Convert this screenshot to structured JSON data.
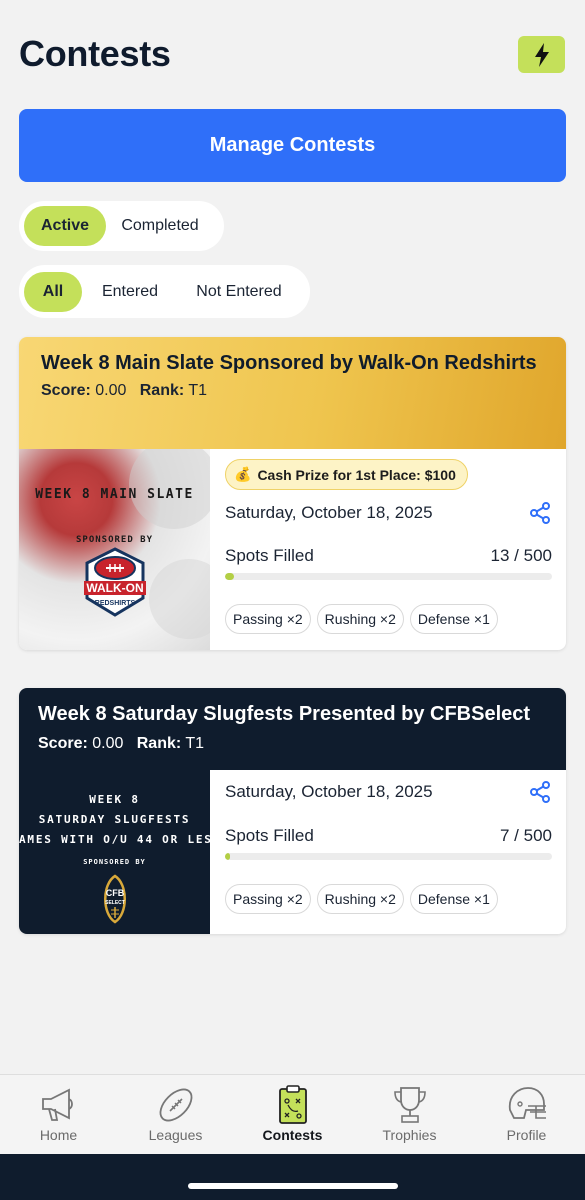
{
  "header": {
    "title": "Contests",
    "action_icon": "lightning-icon"
  },
  "manage_button": "Manage Contests",
  "status_filter": {
    "options": [
      "Active",
      "Completed"
    ],
    "selected": "Active"
  },
  "entry_filter": {
    "options": [
      "All",
      "Entered",
      "Not Entered"
    ],
    "selected": "All"
  },
  "contests": [
    {
      "title": "Week 8 Main Slate Sponsored by Walk-On Redshirts",
      "score_label": "Score:",
      "score": "0.00",
      "rank_label": "Rank:",
      "rank": "T1",
      "thumb": {
        "line1": "WEEK 8 MAIN SLATE",
        "line2": "SPONSORED BY",
        "logo_line1": "WALK-ON",
        "logo_line2": "REDSHIRTS"
      },
      "prize": "Cash Prize for 1st Place: $100",
      "date": "Saturday, October 18, 2025",
      "spots_label": "Spots Filled",
      "spots": "13 / 500",
      "spots_fraction": 0.026,
      "chips": [
        "Passing ×2",
        "Rushing ×2",
        "Defense ×1"
      ]
    },
    {
      "title": "Week 8 Saturday Slugfests Presented by CFBSelect",
      "score_label": "Score:",
      "score": "0.00",
      "rank_label": "Rank:",
      "rank": "T1",
      "thumb": {
        "line1": "WEEK 8",
        "line2": "SATURDAY SLUGFESTS",
        "line3": "AMES WITH O/U 44 OR LES",
        "line4": "SPONSORED BY",
        "logo_line1": "CFB",
        "logo_line2": "SELECT"
      },
      "date": "Saturday, October 18, 2025",
      "spots_label": "Spots Filled",
      "spots": "7 / 500",
      "spots_fraction": 0.014,
      "chips": [
        "Passing ×2",
        "Rushing ×2",
        "Defense ×1"
      ]
    }
  ],
  "tabs": [
    {
      "label": "Home",
      "icon": "megaphone-icon"
    },
    {
      "label": "Leagues",
      "icon": "football-icon"
    },
    {
      "label": "Contests",
      "icon": "clipboard-icon",
      "active": true
    },
    {
      "label": "Trophies",
      "icon": "trophy-icon"
    },
    {
      "label": "Profile",
      "icon": "helmet-icon"
    }
  ],
  "colors": {
    "accent": "#c4e05a",
    "primary": "#2f6ff9",
    "navy": "#0f1c2d",
    "gold": "#efc54e"
  }
}
